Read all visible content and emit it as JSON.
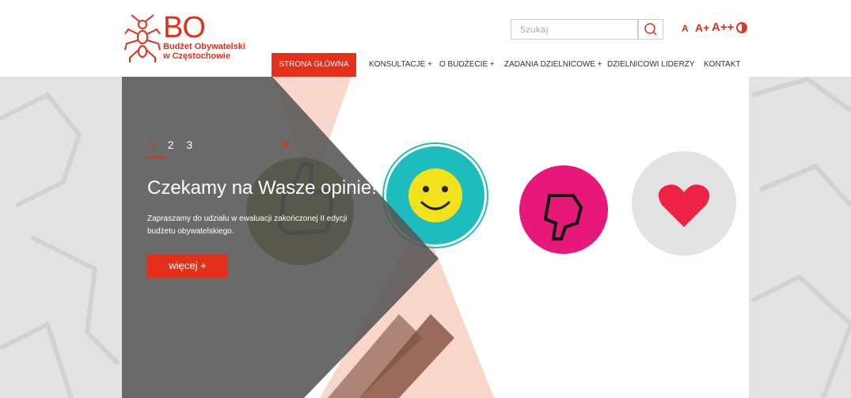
{
  "logo": {
    "bo": "BO",
    "line1": "Budżet Obywatelski",
    "line2": "w Częstochowie"
  },
  "search": {
    "placeholder": "Szukaj"
  },
  "font_sizes": [
    "A",
    "A+",
    "A++"
  ],
  "nav": [
    "STRONA GŁÓWNA",
    "KONSULTACJE  +",
    "O BUDŻECIE  +",
    "ZADANIA DZIELNICOWE  +",
    "DZIELNICOWI LIDERZY",
    "KONTAKT"
  ],
  "slider": {
    "numbers": [
      "1",
      "2",
      "3"
    ],
    "title": "Czekamy na Wasze opinie!",
    "text": "Zapraszamy do udziału w ewaluacji zakończonej II edycji budżetu obywatelskiego.",
    "button": "więcej  +"
  },
  "colors": {
    "accent": "#e2301b",
    "dark_overlay": "#5a5a5a",
    "teal": "#1fbcbf",
    "pink": "#e7187a",
    "olive": "#4a4a10"
  }
}
